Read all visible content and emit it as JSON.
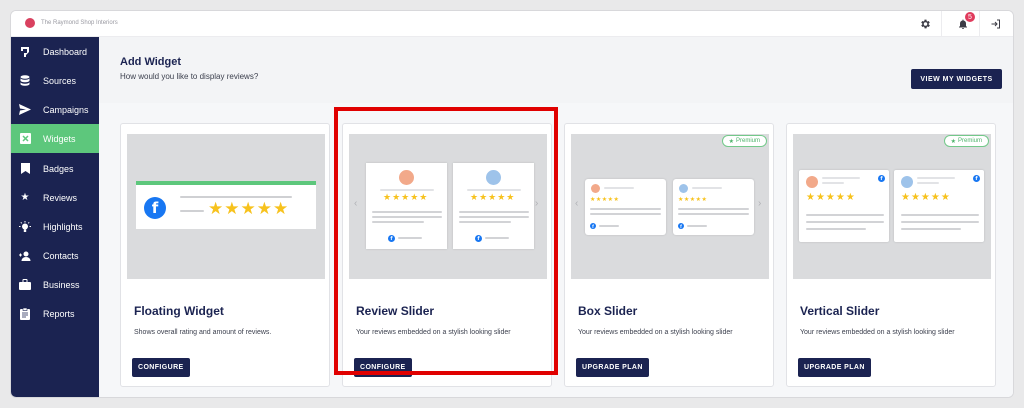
{
  "topbar": {
    "brand_name": "The Raymond Shop Interiors",
    "notification_count": "5"
  },
  "sidebar": {
    "items": [
      {
        "label": "Dashboard",
        "icon": "dashboard-icon"
      },
      {
        "label": "Sources",
        "icon": "database-icon"
      },
      {
        "label": "Campaigns",
        "icon": "send-icon"
      },
      {
        "label": "Widgets",
        "icon": "widget-icon",
        "active": true
      },
      {
        "label": "Badges",
        "icon": "bookmark-icon"
      },
      {
        "label": "Reviews",
        "icon": "star-icon"
      },
      {
        "label": "Highlights",
        "icon": "lightbulb-icon"
      },
      {
        "label": "Contacts",
        "icon": "contacts-icon"
      },
      {
        "label": "Business",
        "icon": "briefcase-icon"
      },
      {
        "label": "Reports",
        "icon": "clipboard-icon"
      }
    ]
  },
  "header": {
    "title": "Add Widget",
    "subtitle": "How would you like to display reviews?",
    "view_button": "VIEW MY WIDGETS"
  },
  "cards": [
    {
      "title": "Floating Widget",
      "desc": "Shows overall rating and amount of reviews.",
      "button": "CONFIGURE",
      "premium": false
    },
    {
      "title": "Review Slider",
      "desc": "Your reviews embedded on a stylish looking slider",
      "button": "CONFIGURE",
      "premium": false
    },
    {
      "title": "Box Slider",
      "desc": "Your reviews embedded on a stylish looking slider",
      "button": "UPGRADE PLAN",
      "premium": true
    },
    {
      "title": "Vertical Slider",
      "desc": "Your reviews embedded on a stylish looking slider",
      "button": "UPGRADE PLAN",
      "premium": true
    }
  ],
  "premium_label": "Premium",
  "stars": "★★★★★",
  "colors": {
    "navy": "#1b2351",
    "active_green": "#5dc77c",
    "highlight_red": "#e00000",
    "star": "#f7c21d",
    "facebook": "#1877f2"
  }
}
